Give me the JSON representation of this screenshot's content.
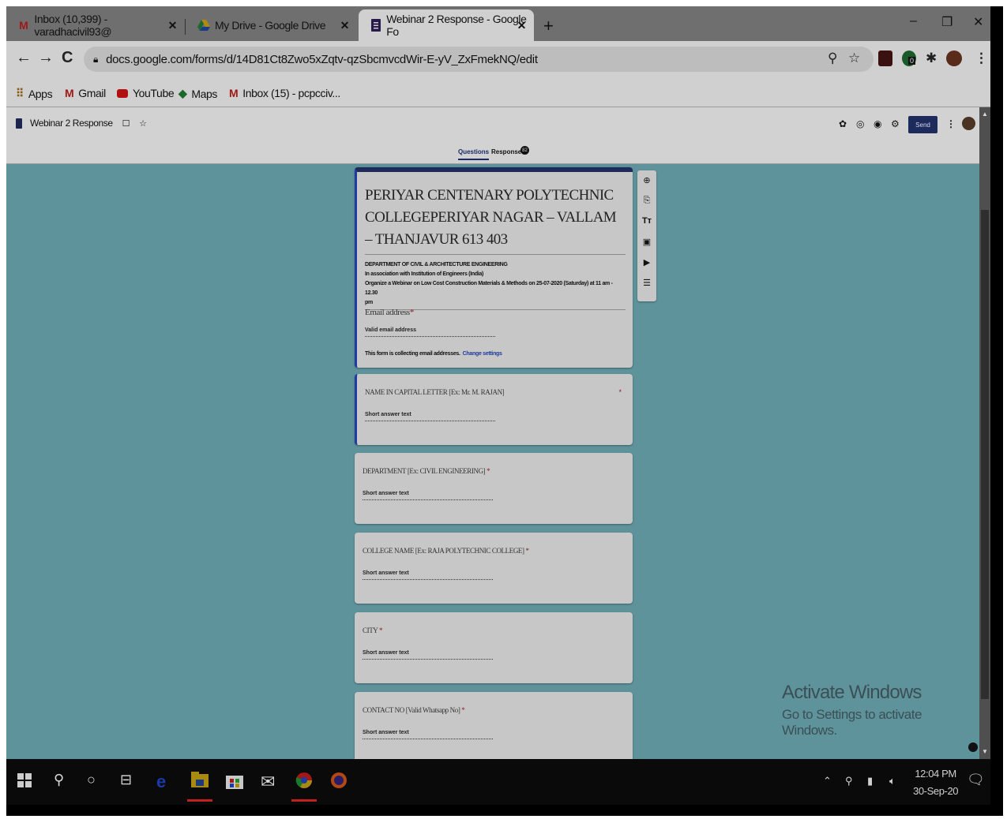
{
  "browser": {
    "tabs": [
      {
        "label": "Inbox (10,399) - varadhacivil93@",
        "icon": "gmail-icon",
        "active": false
      },
      {
        "label": "My Drive - Google Drive",
        "icon": "google-drive-icon",
        "active": false
      },
      {
        "label": "Webinar 2 Response - Google Fo",
        "icon": "google-forms-icon",
        "active": true
      }
    ],
    "new_tab": "+",
    "url": "docs.google.com/forms/d/14D81Ct8Zwo5xZqtv-qzSbcmvcdWir-E-yV_ZxFmekNQ/edit",
    "extension_badge": "0",
    "bookmarks": [
      {
        "label": "Apps",
        "icon": "apps-grid-icon"
      },
      {
        "label": "Gmail",
        "icon": "gmail-icon"
      },
      {
        "label": "YouTube",
        "icon": "youtube-icon"
      },
      {
        "label": "Maps",
        "icon": "maps-icon"
      },
      {
        "label": "Inbox (15) - pcpcciv...",
        "icon": "gmail-icon"
      }
    ]
  },
  "form_header": {
    "title": "Webinar 2 Response",
    "send_label": "Send",
    "tab_questions": "Questions",
    "tab_responses": "Responses",
    "responses_count": "82"
  },
  "form": {
    "title": "PERIYAR CENTENARY POLYTECHNIC COLLEGEPERIYAR NAGAR – VALLAM – THANJAVUR 613 403",
    "description_lines": [
      "DEPARTMENT OF CIVIL & ARCHITECTURE ENGINEERING",
      "In association with Institution of Engineers (India)",
      "Organize a Webinar on Low Cost Construction Materials & Methods on 25-07-2020 (Saturday) at 11 am - 12.30",
      "pm"
    ],
    "email_label": "Email address",
    "required_mark": "*",
    "email_placeholder": "Valid email address",
    "collecting_text": "This form is collecting email addresses.",
    "change_settings": "Change settings",
    "questions": [
      {
        "label": "NAME IN CAPITAL LETTER [Ex: Mr. M. RAJAN]",
        "answer": "Short answer text",
        "required": "*"
      },
      {
        "label": "DEPARTMENT [Ex: CIVIL ENGINEERING]",
        "answer": "Short answer text",
        "required": "*"
      },
      {
        "label": "COLLEGE NAME [Ex: RAJA POLYTECHNIC COLLEGE]",
        "answer": "Short answer text",
        "required": "*"
      },
      {
        "label": "CITY",
        "answer": "Short answer text",
        "required": "*"
      },
      {
        "label": "CONTACT NO [Valid Whatsapp No]",
        "answer": "Short answer text",
        "required": "*"
      }
    ]
  },
  "watermark": {
    "title": "Activate Windows",
    "subtitle": "Go to Settings to activate Windows."
  },
  "taskbar": {
    "time": "12:04 PM",
    "date": "30-Sep-20"
  }
}
